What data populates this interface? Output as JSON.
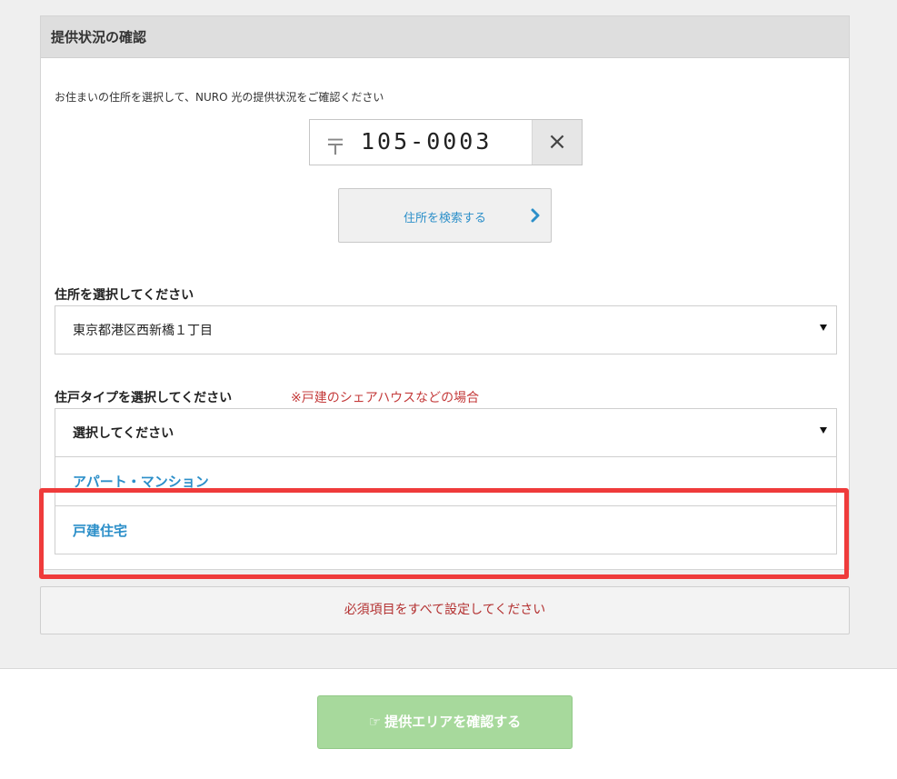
{
  "panel": {
    "title": "提供状況の確認",
    "intro": "お住まいの住所を選択して、NURO 光の提供状況をご確認ください"
  },
  "zip": {
    "mark": "〒",
    "value": "105-0003",
    "clear": "×"
  },
  "search": {
    "label": "住所を検索する"
  },
  "address": {
    "label": "住所を選択してください",
    "selected": "東京都港区西新橋１丁目"
  },
  "housing": {
    "label": "住戸タイプを選択してください",
    "note": "※戸建のシェアハウスなどの場合",
    "selected": "選択してください",
    "options": [
      {
        "label": "アパート・マンション"
      },
      {
        "label": "戸建住宅"
      }
    ]
  },
  "required_message": "必須項目をすべて設定してください",
  "confirm": {
    "icon": "☞",
    "label": "提供エリアを確認する"
  },
  "colors": {
    "accent": "#2c8fc9",
    "error": "#c43b3b",
    "highlight": "#ef3b3b",
    "confirm_button": "#a7d99c"
  }
}
